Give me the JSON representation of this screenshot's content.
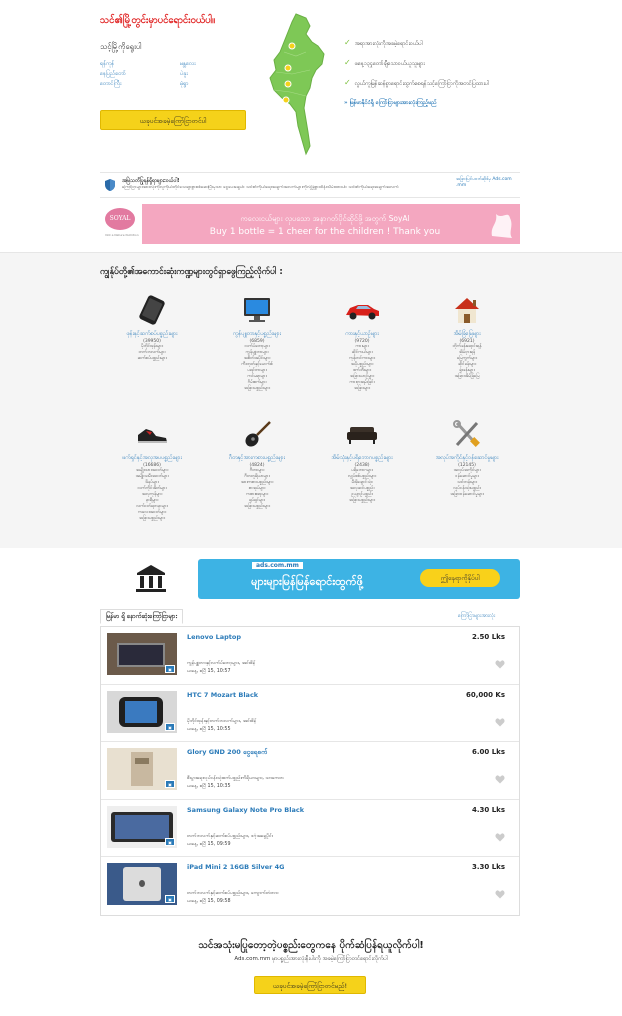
{
  "hero": {
    "title": "သင်၏မြို့တွင်းမှာပင်ရောင်းဝယ်ပါ။",
    "subtitle": "သင့်မြို့ကိုရွေးပါ",
    "cities_left": [
      "ရန်ကုန်",
      "နေပြည်တော်",
      "တောင်ကြီး"
    ],
    "cities_right": [
      "မန္တလေး",
      "ပဲခူး",
      "မုံရွာ"
    ],
    "post_button": "ယခုပင်အခမဲ့ကြော်ငြာတင်ပါ"
  },
  "features": {
    "items": [
      "အရာအားလုံးကိုအခမဲ့ရောင်းဝယ်ပါ",
      "ဖနေ့၁၃၄ုတော်ချီသောဝယ်ယူသူများ",
      "လွယ်ကူမြန်ဆန်စွာရောင်းထွက်စေရန်သင့်ကြော်ငြာကိုအတင်ပြထားပါ"
    ],
    "link": "» မြန်မာနိုင်ငံရှိ ကြော်ငြာများအားလုံးကြည့်မည်"
  },
  "notice": {
    "title": "အမြဲသတိပြုရန်ရှိရာများ:ဝယ်ပါ!",
    "body": "ကြော်ငြာများအားလုံးကိုလူကိုယ်တိုင်သေချာစွာစစ်ဆေးပြီးမှသာ ငွေပေးချေပါ။ သင်၏ကိုယ်ရေးအချက်အလက်များကိုလုံခြုံစွာထိန်းသိမ်းထားပါ။ သင်၏ကိုယ်ရေးအချက်အလက်",
    "side": "အခြားပြင်ပဝဘ်ဆိုဒ်မှ Ads.com .mm"
  },
  "banner": {
    "logo": "SOYAL",
    "logo_sub": "Not a Nature Nutrition",
    "line1": "ကလေးငယ်များ လှပသော အနာဂတ်ပိုင်ဆိုင်ဖို့ အတွက် SoyAl",
    "line2": "Buy 1 bottle = 1 cheer for the children ! Thank you"
  },
  "categories": {
    "heading": "ကျွန်ုပ်တို့၏အကောင်းဆုံးကဏ္ဍများတွင်ရှာဖွေကြည့်လိုက်ပါ :",
    "items": [
      {
        "icon": "phone-icon",
        "title": "ဖုန်းနှင့်ဆက်စပ်ပစ္စည်းများ",
        "count": "(39950)",
        "subs": [
          "မိုဘိုင်းဖုန်းများ",
          "တက်ဘလက်များ",
          "ဆက်စပ်ပစ္စည်းများ"
        ]
      },
      {
        "icon": "computer-icon",
        "title": "ကွန်ပျူတာနှင့်ပစ္စည်းများ",
        "count": "(6859)",
        "subs": [
          "လက်ပ်တော့များ",
          "ကွန်ပျူတာများ",
          "အစိတ်အပိုင်းများ",
          "ကီးဘုတ်နှင့်မောက်စ်",
          "ပရင်တာများ",
          "ကင်မရာများ",
          "ဂိမ်းစက်များ",
          "အခြားပစ္စည်းများ"
        ]
      },
      {
        "icon": "car-icon",
        "title": "ကားနှင့်ယာဉ်များ",
        "count": "(9720)",
        "subs": [
          "ကားများ",
          "ဆိုင်ကယ်များ",
          "ကုန်တင်ကားများ",
          "အပိုပစ္စည်းများ",
          "စက်ဘီးများ",
          "အခြားယာဉ်များ",
          "ကားငှားရမ်းခြင်း",
          "အခြားများ"
        ]
      },
      {
        "icon": "house-icon",
        "title": "အိမ်ခြံမြေများ",
        "count": "(6921)",
        "subs": [
          "တိုက်ခန်းရောင်းရန်",
          "အိမ်ငှားရန်",
          "မြေကွက်များ",
          "ဆိုင်ခန်းများ",
          "ရုံးခန်းများ",
          "အခြားအိမ်ခြံမြေ"
        ]
      },
      {
        "icon": "shoe-icon",
        "title": "ဖက်ရှင်နှင့်အလှအပပစ္စည်းများ",
        "count": "(16686)",
        "subs": [
          "အမျိုးသားအဝတ်များ",
          "အမျိုးသမီးအဝတ်များ",
          "ဖိနပ်များ",
          "လက်ကိုင်အိတ်များ",
          "အလှကုန်များ",
          "နာရီများ",
          "လက်ဝတ်ရတနာများ",
          "ကလေးအဝတ်များ",
          "အခြားပစ္စည်းများ"
        ]
      },
      {
        "icon": "guitar-icon",
        "title": "ဂီတနှင့်အားကစားပစ္စည်းများ",
        "count": "(4824)",
        "subs": [
          "ဂီတာများ",
          "ဂီတတူရိယာများ",
          "အားကစားပစ္စည်းများ",
          "စာအုပ်များ",
          "ကစားစရာများ",
          "ရုပ်ရှင်များ",
          "အခြားပစ္စည်းများ"
        ]
      },
      {
        "icon": "sofa-icon",
        "title": "အိမ်သုံးနှင့်ပရိဘောဂပစ္စည်းများ",
        "count": "(2438)",
        "subs": [
          "ပရိဘောဂများ",
          "လျှပ်စစ်ပစ္စည်းများ",
          "မီးဖိုချောင်သုံး",
          "အလှဆင်ပစ္စည်း",
          "ဥယျာဉ်ပစ္စည်း",
          "အခြားပစ္စည်းများ"
        ]
      },
      {
        "icon": "tools-icon",
        "title": "အလုပ်အကိုင်နှင့်ဝန်ဆောင်မှုများ",
        "count": "(12145)",
        "subs": [
          "အလုပ်အကိုင်များ",
          "ဝန်ဆောင်မှုများ",
          "သင်တန်းများ",
          "လုပ်ငန်းသုံးပစ္စည်း",
          "အခြားဝန်ဆောင်မှုများ"
        ]
      }
    ]
  },
  "ads_banner": {
    "logo": "ads.com.mm",
    "text": "များများမြန်မြန်ရောင်းထွက်ဖို့",
    "button": "ဤနေရာကိုနှိပ်ပါ"
  },
  "latest": {
    "tab": "မြန်မာ ရှိ နောက်ဆုံးကြော်ငြာများ",
    "all_link": "ကြော်ငြာများအားလုံး",
    "items": [
      {
        "title": "Lenovo Laptop",
        "price": "2.50 Lks",
        "category": "ကွန်ပျူတာနှင့်လက်ပ်တော့များ, အင်းစိန်",
        "time": "ယနေ့, ဧပြီ 15, 10:57",
        "thumb_color": "#6b5a4a"
      },
      {
        "title": "HTC 7 Mozart Black",
        "price": "60,000 Ks",
        "category": "မိုဘိုင်းဖုန်းနှင့်တက်ဘလက်များ, အင်းစိန်",
        "time": "ယနေ့, ဧပြီ 15, 10:55",
        "thumb_color": "#1f1f1f"
      },
      {
        "title": "Glory GND 200 ငွေရေစက်",
        "price": "6.00 Lks",
        "category": "စီးပွားရေးလုပ်ငန်းသုံးစက်ပစ္စည်းကိရိယာများ, သာကေတ",
        "time": "ယနေ့, ဧပြီ 15, 10:35",
        "thumb_color": "#c8b8a0"
      },
      {
        "title": "Samsung Galaxy Note Pro Black",
        "price": "4.30 Lks",
        "category": "တက်ဘလက်နှင့်ဆက်စပ်ပစ္စည်းများ, ဒဂုံအရှေ့ပိုင်း",
        "time": "ယနေ့, ဧပြီ 15, 09:59",
        "thumb_color": "#2a2a2a"
      },
      {
        "title": "iPad Mini 2 16GB Silver 4G",
        "price": "3.30 Lks",
        "category": "တက်ဘလက်နှင့်ဆက်စပ်ပစ္စည်းများ, ကျောက်တံတား",
        "time": "ယနေ့, ဧပြီ 15, 09:58",
        "thumb_color": "#3a5a8a"
      }
    ]
  },
  "footer": {
    "title": "သင်အသုံးမပြုတော့တဲ့ပစ္စည်းတွေကနေ ပိုက်ဆံပြန်ရယူလိုက်ပါ!",
    "sub": "Ads.com.mm မှာပစ္စည်းအားလုံးနီးပါးကို အခမဲ့ကြော်ငြာတင်ရောင်းလိုက်ပါ",
    "button": "ယခုပင်အခမဲ့ကြော်ငြာတင်မည်!"
  },
  "colors": {
    "accent_red": "#e02020",
    "link_blue": "#2a7ab8",
    "button_yellow": "#f5d21a",
    "map_green": "#7ec856",
    "check_green": "#7bbf3a"
  }
}
